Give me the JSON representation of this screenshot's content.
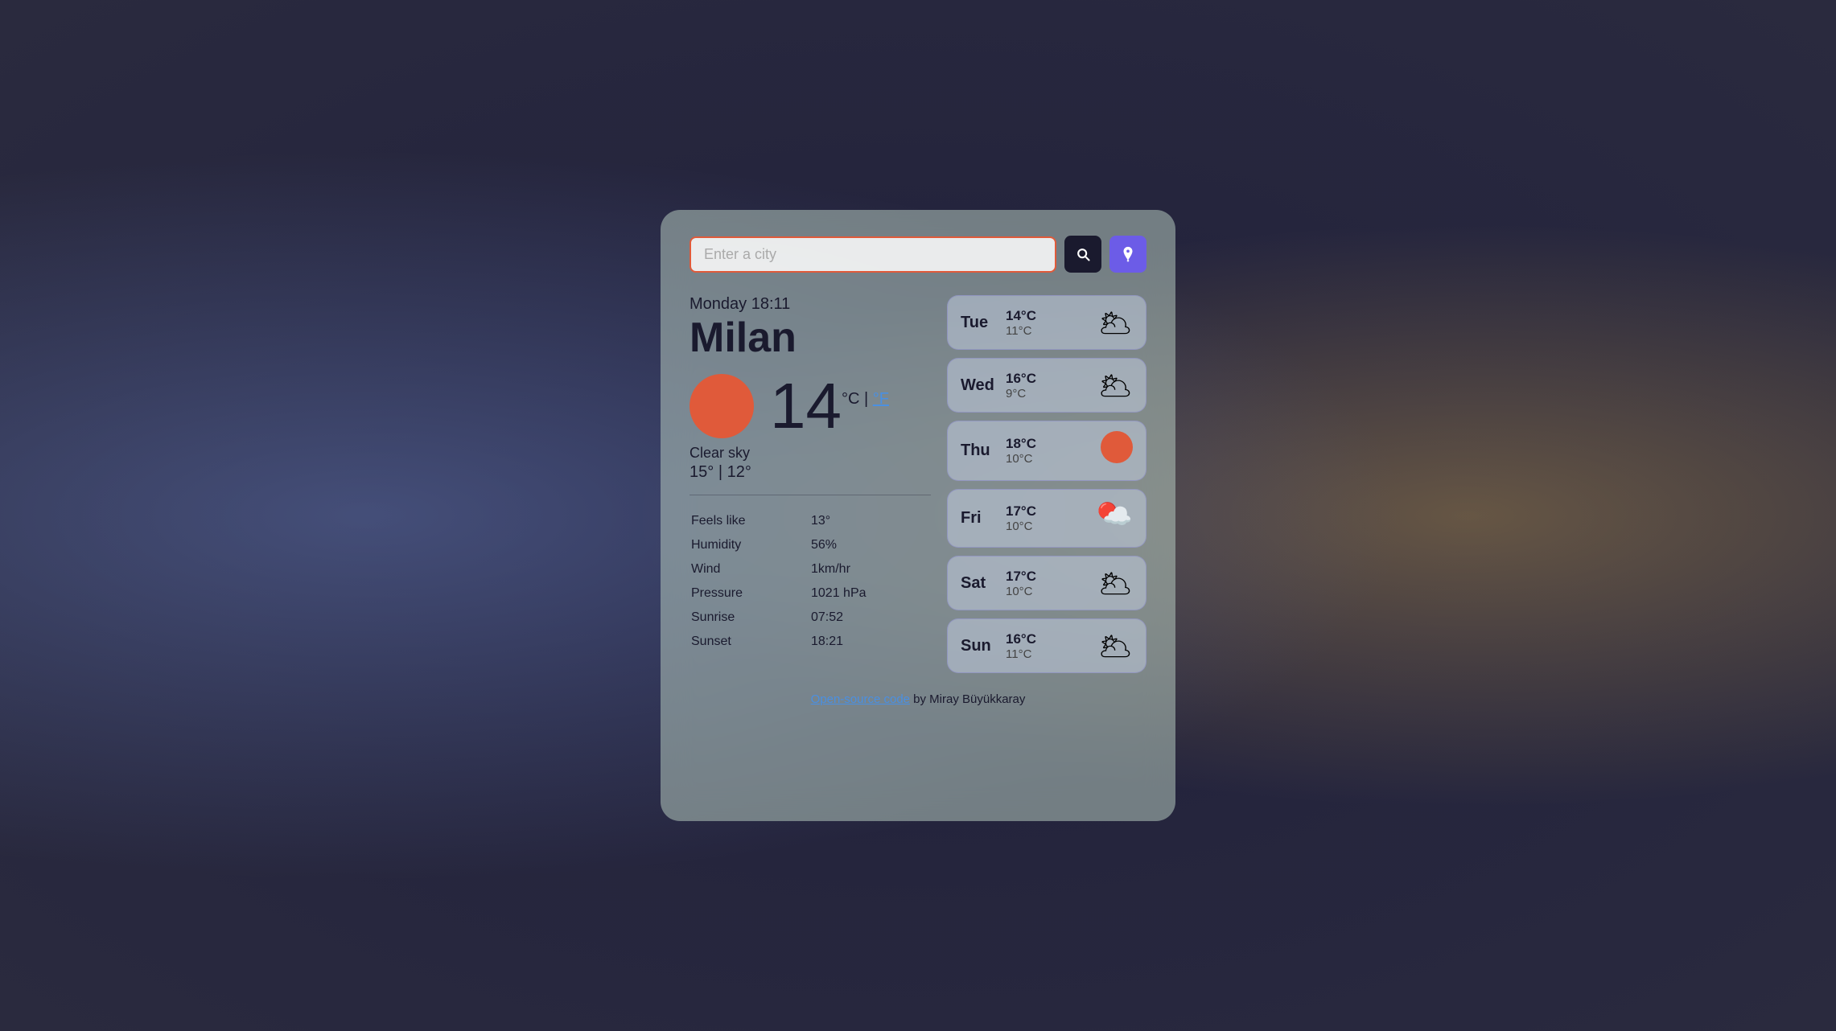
{
  "background": {
    "colors": [
      "#2a2a3e",
      "rgba(100,120,180,0.5)",
      "rgba(200,160,80,0.4)"
    ]
  },
  "search": {
    "placeholder": "Enter a city",
    "search_btn_label": "🔍",
    "location_btn_label": "📍"
  },
  "current": {
    "datetime": "Monday 18:11",
    "city": "Milan",
    "temperature": "14",
    "unit_celsius": "°C",
    "unit_separator": " | ",
    "unit_fahrenheit": "°F",
    "condition": "Clear sky",
    "high": "15°",
    "low": "12°",
    "feels_like_label": "Feels like",
    "feels_like_value": "13°",
    "humidity_label": "Humidity",
    "humidity_value": "56%",
    "wind_label": "Wind",
    "wind_value": "1km/hr",
    "pressure_label": "Pressure",
    "pressure_value": "1021 hPa",
    "sunrise_label": "Sunrise",
    "sunrise_value": "07:52",
    "sunset_label": "Sunset",
    "sunset_value": "18:21"
  },
  "forecast": [
    {
      "day": "Tue",
      "high": "14°C",
      "low": "11°C",
      "icon": "cloudy",
      "icon_char": "🌥"
    },
    {
      "day": "Wed",
      "high": "16°C",
      "low": "9°C",
      "icon": "cloudy",
      "icon_char": "☁️"
    },
    {
      "day": "Thu",
      "high": "18°C",
      "low": "10°C",
      "icon": "sunny",
      "icon_char": "🔴"
    },
    {
      "day": "Fri",
      "high": "17°C",
      "low": "10°C",
      "icon": "partly-cloudy",
      "icon_char": "⛅"
    },
    {
      "day": "Sat",
      "high": "17°C",
      "low": "10°C",
      "icon": "cloudy",
      "icon_char": "🌥"
    },
    {
      "day": "Sun",
      "high": "16°C",
      "low": "11°C",
      "icon": "cloudy",
      "icon_char": "🌥"
    }
  ],
  "footer": {
    "link_text": "Open-source code",
    "link_url": "#",
    "author_text": " by Miray Büyükkaray"
  }
}
